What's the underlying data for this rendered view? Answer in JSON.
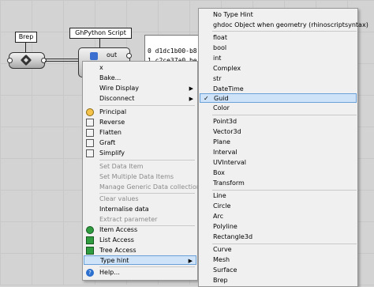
{
  "canvas": {
    "brep": {
      "label": "Brep"
    },
    "ghpython": {
      "title": "GhPython Script",
      "out_label": "out",
      "in_label": "x"
    },
    "panel": {
      "lines": [
        "0 d1dc1b00-b8",
        "1 c2ce37a0 be"
      ]
    }
  },
  "context_menu": {
    "items": [
      {
        "label": "x",
        "enabled": true
      },
      {
        "label": "Bake...",
        "enabled": true,
        "icon": "bake-icon"
      },
      {
        "label": "Wire Display",
        "enabled": true,
        "submenu": true
      },
      {
        "label": "Disconnect",
        "enabled": true,
        "submenu": true
      },
      {
        "label": "Principal",
        "enabled": true,
        "icon": "principal-icon"
      },
      {
        "label": "Reverse",
        "enabled": true,
        "icon": "reverse-icon"
      },
      {
        "label": "Flatten",
        "enabled": true,
        "icon": "flatten-icon"
      },
      {
        "label": "Graft",
        "enabled": true,
        "icon": "graft-icon"
      },
      {
        "label": "Simplify",
        "enabled": true,
        "icon": "simplify-icon"
      },
      {
        "label": "Set Data Item",
        "enabled": false
      },
      {
        "label": "Set Multiple Data Items",
        "enabled": false
      },
      {
        "label": "Manage Generic Data collection",
        "enabled": false
      },
      {
        "label": "Clear values",
        "enabled": false
      },
      {
        "label": "Internalise data",
        "enabled": true
      },
      {
        "label": "Extract parameter",
        "enabled": false
      },
      {
        "label": "Item Access",
        "enabled": true,
        "icon": "item-access-icon"
      },
      {
        "label": "List Access",
        "enabled": true,
        "icon": "list-access-icon"
      },
      {
        "label": "Tree Access",
        "enabled": true,
        "icon": "tree-access-icon"
      },
      {
        "label": "Type hint",
        "enabled": true,
        "submenu": true,
        "highlighted": true
      },
      {
        "label": "Help...",
        "enabled": true,
        "icon": "help-icon"
      }
    ],
    "arrow_glyph": "▶"
  },
  "type_hint_menu": {
    "checked": "Guid",
    "check_glyph": "✓",
    "items": [
      "No Type Hint",
      "ghdoc Object when geometry (rhinoscriptsyntax)",
      "float",
      "bool",
      "int",
      "Complex",
      "str",
      "DateTime",
      "Guid",
      "Color",
      "Point3d",
      "Vector3d",
      "Plane",
      "Interval",
      "UVInterval",
      "Box",
      "Transform",
      "Line",
      "Circle",
      "Arc",
      "Polyline",
      "Rectangle3d",
      "Curve",
      "Mesh",
      "Surface",
      "Brep"
    ]
  },
  "colors": {
    "menu_bg": "#f0f0f0",
    "highlight_bg": "#cfe3f8",
    "highlight_border": "#6aa0d8"
  }
}
